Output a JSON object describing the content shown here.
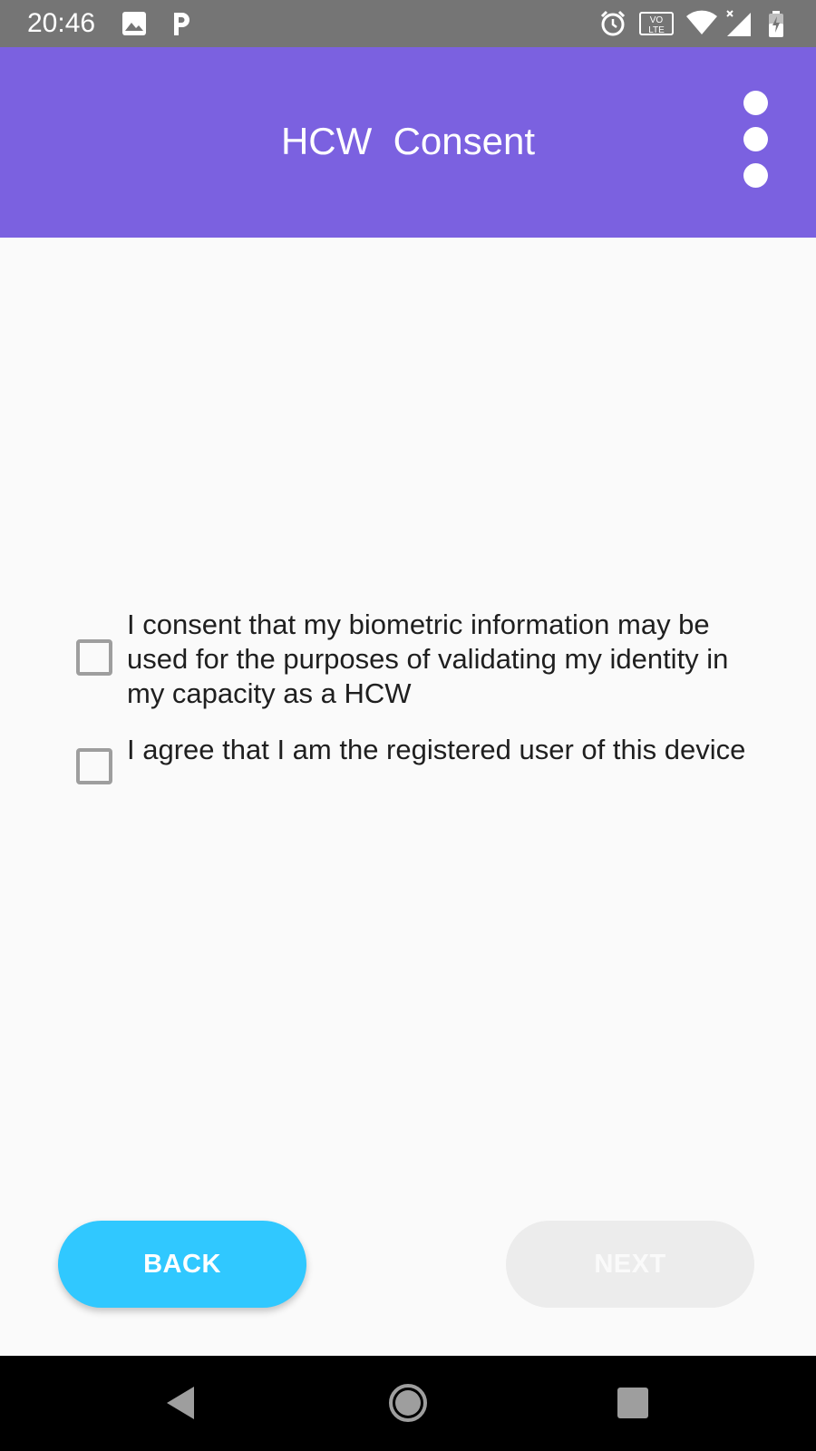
{
  "status_bar": {
    "time": "20:46",
    "network_label": "VO LTE",
    "icons": [
      "image-icon",
      "parking-icon",
      "alarm-icon",
      "volte-icon",
      "wifi-icon",
      "signal-icon",
      "battery-icon"
    ]
  },
  "app_bar": {
    "title": "HCW  Consent",
    "background_color": "#7b61e0",
    "menu_icon": "overflow-menu-icon"
  },
  "consent": {
    "options": [
      {
        "label": "I consent that my biometric information may be used for the purposes of validating my identity in my capacity as a HCW",
        "checked": false
      },
      {
        "label": "I agree that I am the registered user of this device",
        "checked": false
      }
    ]
  },
  "buttons": {
    "back_label": "BACK",
    "next_label": "NEXT",
    "back_color": "#30c8ff",
    "next_enabled": false
  },
  "nav_bar": {
    "icons": [
      "back-nav-icon",
      "home-nav-icon",
      "recents-nav-icon"
    ]
  }
}
